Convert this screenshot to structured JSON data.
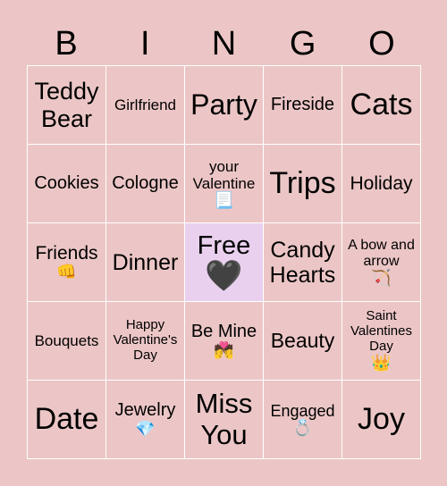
{
  "header": [
    "B",
    "I",
    "N",
    "G",
    "O"
  ],
  "cells": [
    {
      "text": "Teddy Bear",
      "size": 27
    },
    {
      "text": "Girlfriend",
      "size": 17
    },
    {
      "text": "Party",
      "size": 32
    },
    {
      "text": "Fireside",
      "size": 20
    },
    {
      "text": "Cats",
      "size": 34
    },
    {
      "text": "Cookies",
      "size": 20
    },
    {
      "text": "Cologne",
      "size": 20
    },
    {
      "text": "your Valentine",
      "size": 17,
      "emoji": "📃"
    },
    {
      "text": "Trips",
      "size": 34
    },
    {
      "text": "Holiday",
      "size": 21
    },
    {
      "text": "Friends",
      "size": 21,
      "emoji": "👊"
    },
    {
      "text": "Dinner",
      "size": 25
    },
    {
      "text": "Free",
      "size": 29,
      "emoji": "🖤",
      "free": true
    },
    {
      "text": "Candy Hearts",
      "size": 25
    },
    {
      "text": "A bow and arrow",
      "size": 16,
      "emoji": "🏹"
    },
    {
      "text": "Bouquets",
      "size": 17
    },
    {
      "text": "Happy Valentine's Day",
      "size": 15
    },
    {
      "text": "Be Mine",
      "size": 20,
      "emoji": "💏"
    },
    {
      "text": "Beauty",
      "size": 23
    },
    {
      "text": "Saint Valentines Day",
      "size": 15,
      "emoji": "👑"
    },
    {
      "text": "Date",
      "size": 34
    },
    {
      "text": "Jewelry",
      "size": 20,
      "emoji": "💎"
    },
    {
      "text": "Miss You",
      "size": 31
    },
    {
      "text": "Engaged",
      "size": 18,
      "emoji": "💍"
    },
    {
      "text": "Joy",
      "size": 34
    }
  ],
  "colors": {
    "background": "#ecc6c6",
    "free_cell": "#e9d0ee",
    "grid_lines": "#ffffff"
  }
}
